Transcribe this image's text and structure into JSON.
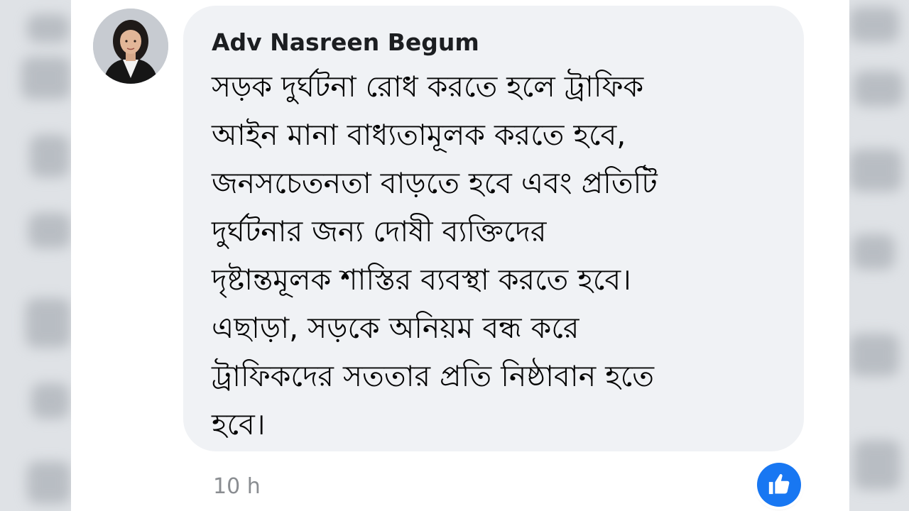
{
  "comment": {
    "author": "Adv Nasreen Begum",
    "lines": [
      "সড়ক দুর্ঘটনা রোধ করতে হলে ট্রাফিক",
      "আইন মানা বাধ্যতামূলক করতে হবে,",
      "জনসচেতনতা বাড়তে হবে এবং প্রতিটি",
      "দুর্ঘটনার জন্য দোষী ব্যক্তিদের",
      "দৃষ্টান্তমূলক শাস্তির ব্যবস্থা করতে হবে।",
      "এছাড়া, সড়কে অনিয়ম বন্ধ করে",
      "ট্রাফিকদের সততার প্রতি নিষ্ঠাবান হতে",
      "হবে।"
    ],
    "timestamp": "10 h",
    "reaction_icon": "like-icon"
  },
  "colors": {
    "bubble": "#f0f2f5",
    "author_text": "#1c1e21",
    "body_text": "#050505",
    "timestamp_text": "#8a8d91",
    "like_blue": "#1877f2"
  }
}
